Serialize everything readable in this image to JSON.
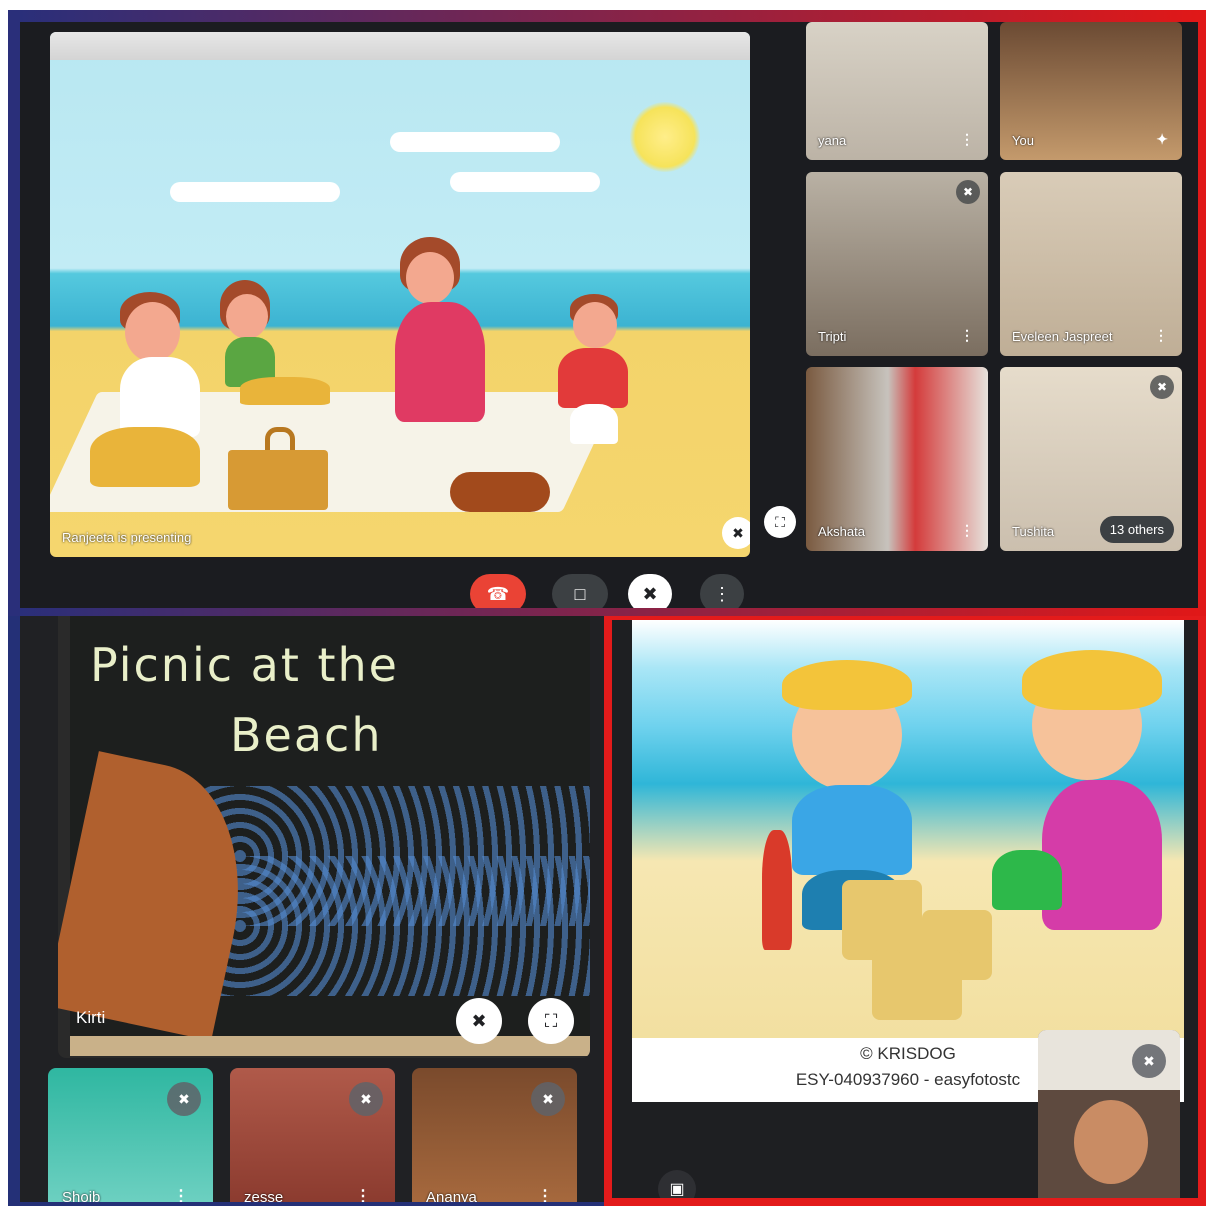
{
  "meet_top": {
    "presenting_label": "Ranjeeta is presenting",
    "tiles": [
      {
        "name": "yana",
        "muted": false
      },
      {
        "name": "You",
        "muted": false
      },
      {
        "name": "Tripti",
        "muted": true
      },
      {
        "name": "Eveleen Jaspreet",
        "muted": false
      },
      {
        "name": "Akshata",
        "muted": false
      },
      {
        "name": "Tushita",
        "muted": true
      }
    ],
    "others_label": "13 others",
    "controls": {
      "end_call": "end-call-icon",
      "camera": "camera-icon",
      "mic": "mic-off-icon",
      "more": "more-vert-icon"
    },
    "colors": {
      "end_call": "#ea4335",
      "control_bg": "#3c4043",
      "panel_bg": "#202124"
    }
  },
  "meet_bottom_left": {
    "board_title_line1": "Picnic at the",
    "board_title_line2": "Beach",
    "speaker_name": "Kirti",
    "participants": [
      {
        "name": "Shoib"
      },
      {
        "name": "zesse"
      },
      {
        "name": "Ananya"
      }
    ]
  },
  "meet_bottom_right": {
    "credit_line1": "© KRISDOG",
    "credit_line2": "ESY-040937960 - easyfotostc"
  },
  "frame_colors": {
    "blue": "#243077",
    "red": "#e31b1b"
  }
}
